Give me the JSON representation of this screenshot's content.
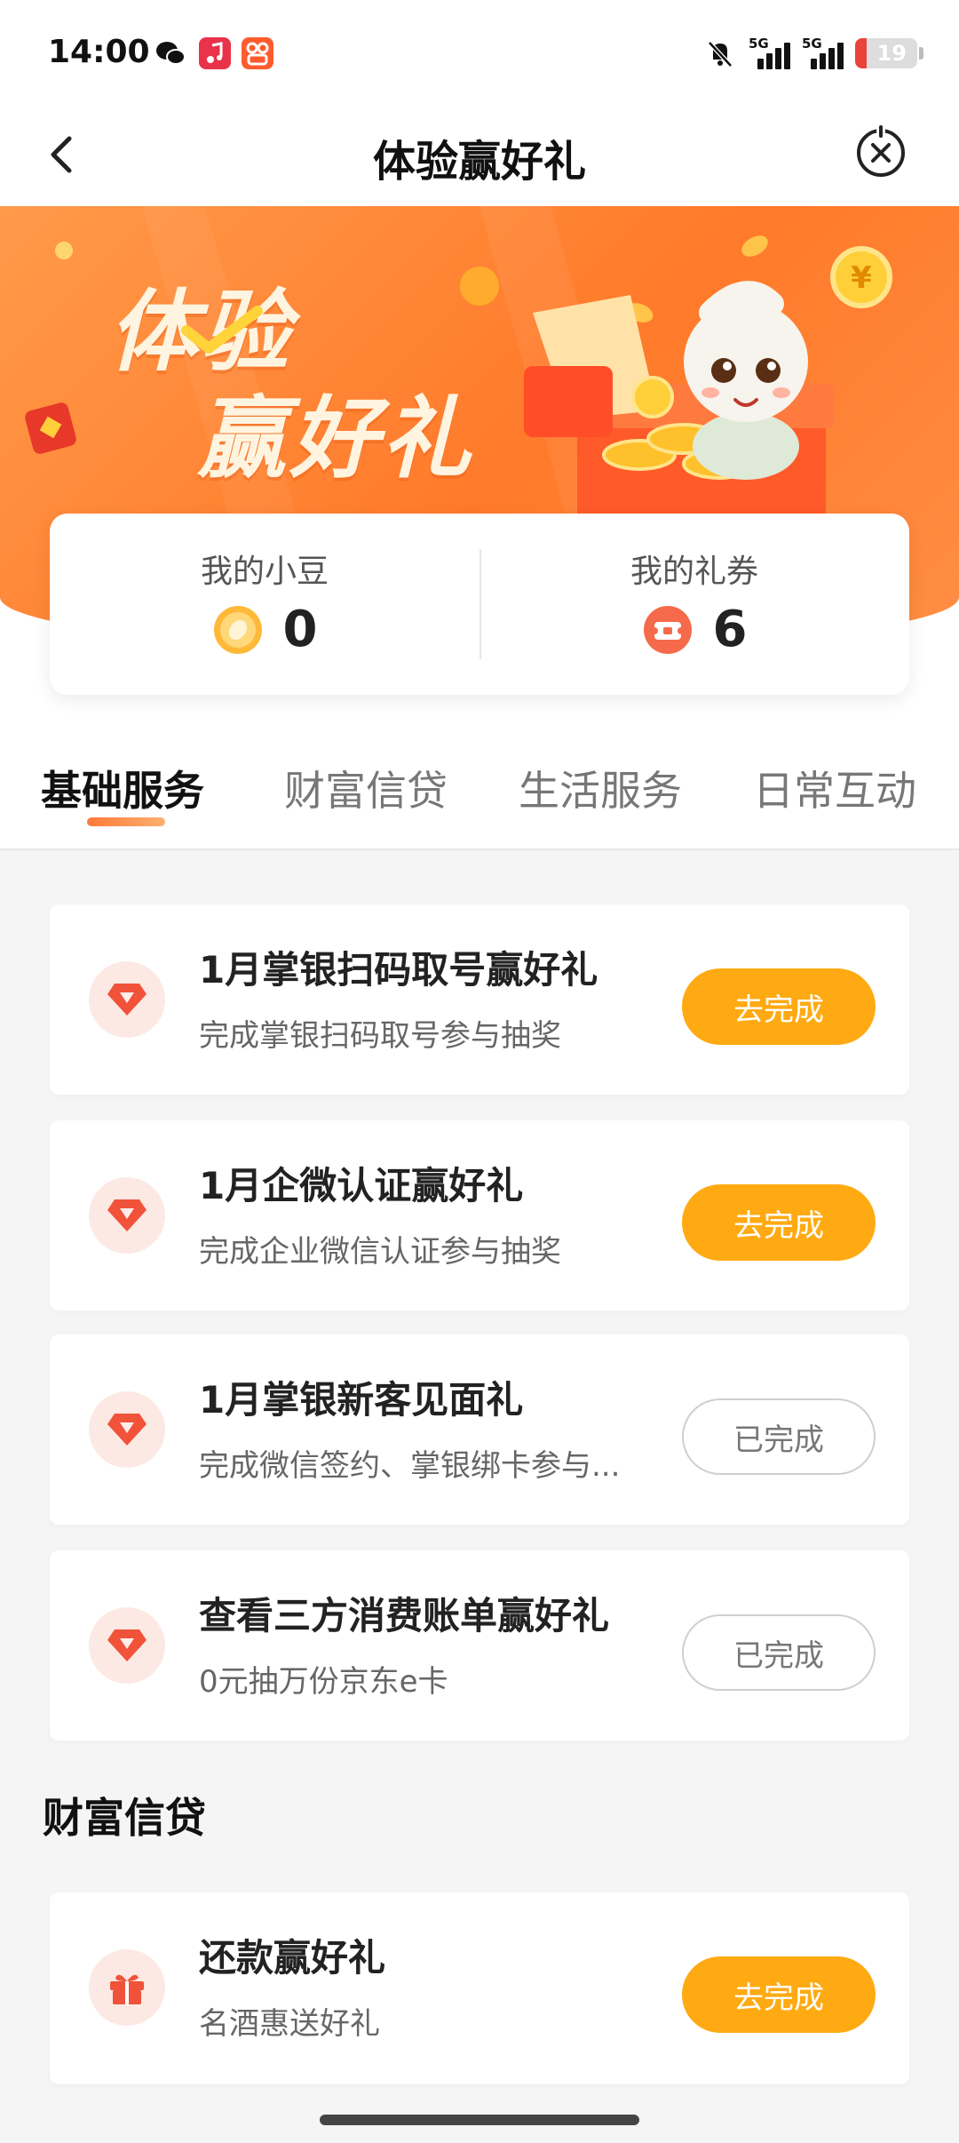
{
  "status_bar": {
    "time": "14:00",
    "network_1": "5G",
    "network_2": "5G",
    "battery": "19",
    "battery_level": 0.19,
    "apps": [
      "wechat-icon",
      "music-icon",
      "kuaishou-icon"
    ]
  },
  "nav": {
    "title": "体验赢好礼",
    "back_icon": "chevron-left-icon",
    "close_icon": "close-circle-icon"
  },
  "banner": {
    "title_line1": "体验",
    "title_line2": "赢好礼"
  },
  "points": {
    "beans_label": "我的小豆",
    "beans_value": "0",
    "coupons_label": "我的礼券",
    "coupons_value": "6"
  },
  "tabs": [
    {
      "label": "基础服务",
      "active": true
    },
    {
      "label": "财富信贷",
      "active": false
    },
    {
      "label": "生活服务",
      "active": false
    },
    {
      "label": "日常互动",
      "active": false
    }
  ],
  "tasks": [
    {
      "title": "1月掌银扫码取号赢好礼",
      "desc": "完成掌银扫码取号参与抽奖",
      "button": "去完成",
      "status": "todo",
      "icon": "diamond-icon"
    },
    {
      "title": "1月企微认证赢好礼",
      "desc": "完成企业微信认证参与抽奖",
      "button": "去完成",
      "status": "todo",
      "icon": "diamond-icon"
    },
    {
      "title": "1月掌银新客见面礼",
      "desc": "完成微信签约、掌银绑卡参与...",
      "button": "已完成",
      "status": "done",
      "icon": "diamond-icon"
    },
    {
      "title": "查看三方消费账单赢好礼",
      "desc": "0元抽万份京东e卡",
      "button": "已完成",
      "status": "done",
      "icon": "diamond-icon"
    }
  ],
  "section_wealth": {
    "title": "财富信贷",
    "tasks": [
      {
        "title": "还款赢好礼",
        "desc": "名酒惠送好礼",
        "button": "去完成",
        "status": "todo",
        "icon": "gift-icon"
      }
    ]
  },
  "colors": {
    "accent_orange": "#ff7a2a",
    "button_yellow": "#ffaa13",
    "icon_red": "#f0533a"
  }
}
